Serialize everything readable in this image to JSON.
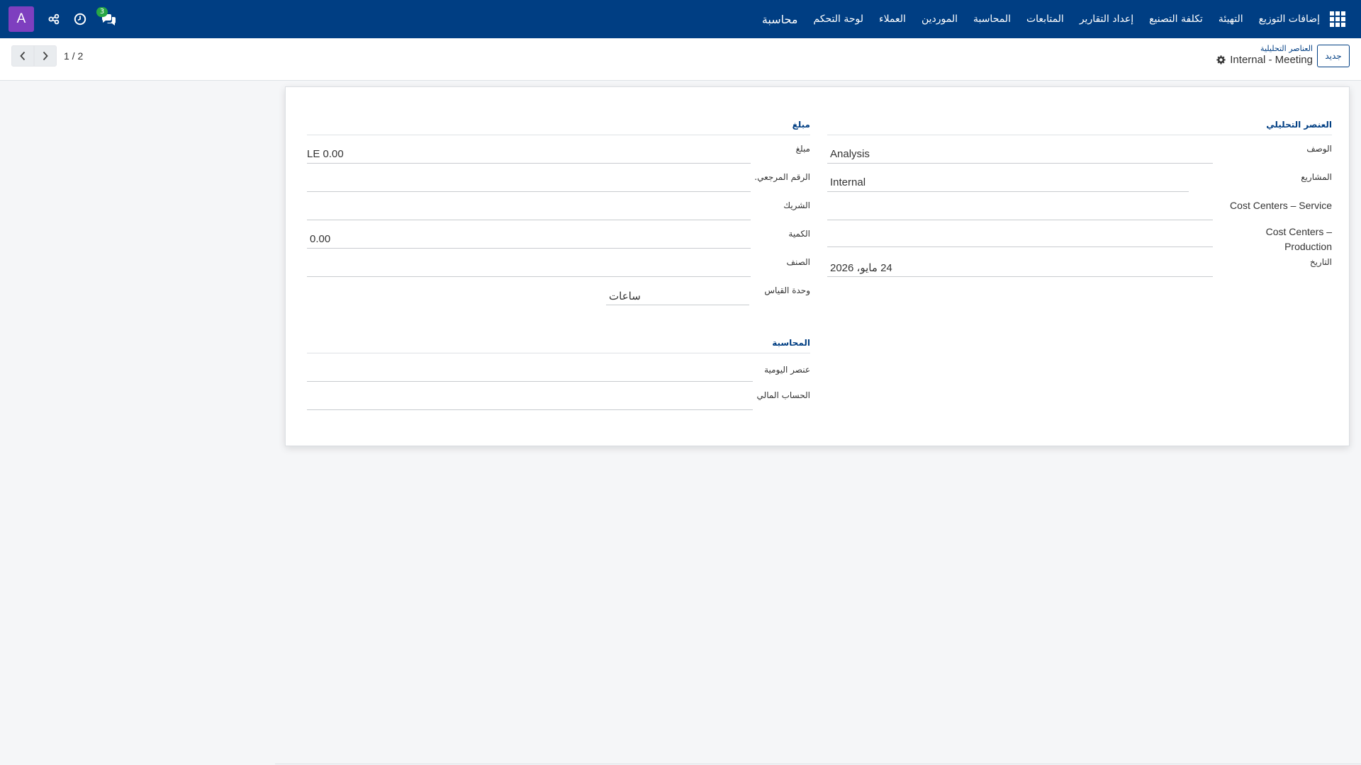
{
  "navbar": {
    "brand": "محاسبة",
    "menu": [
      "لوحة التحكم",
      "العملاء",
      "الموردين",
      "المحاسبة",
      "المتابعات",
      "إعداد التقارير",
      "تكلفة التصنيع",
      "التهيئة",
      "إضافات التوزيع"
    ],
    "avatar_letter": "A",
    "chat_badge": "3"
  },
  "control": {
    "pager_value": "1 / 2",
    "new_button": "جديد",
    "breadcrumb_parent": "العناصر التحليلية",
    "breadcrumb_current": "Internal - Meeting"
  },
  "form": {
    "analytic": {
      "title": "العنصر التحليلي",
      "description_label": "الوصف",
      "description_value": "Analysis",
      "projects_label": "المشاريع",
      "projects_value": "Internal",
      "cc_service_label": "Cost Centers – Service",
      "cc_production_label": "Cost Centers – Production",
      "date_label": "التاريخ",
      "date_value": "24 مايو، 2026"
    },
    "amount": {
      "title": "مبلغ",
      "amount_label": "مبلغ",
      "amount_value": "LE 0.00",
      "reference_label": "الرقم المرجعي.",
      "partner_label": "الشريك",
      "quantity_label": "الكمية",
      "quantity_value": "0.00",
      "product_label": "الصنف",
      "uom_label": "وحدة القياس",
      "uom_value": "ساعات"
    },
    "accounting": {
      "title": "المحاسبة",
      "journal_item_label": "عنصر اليومية",
      "financial_account_label": "الحساب المالي"
    }
  }
}
